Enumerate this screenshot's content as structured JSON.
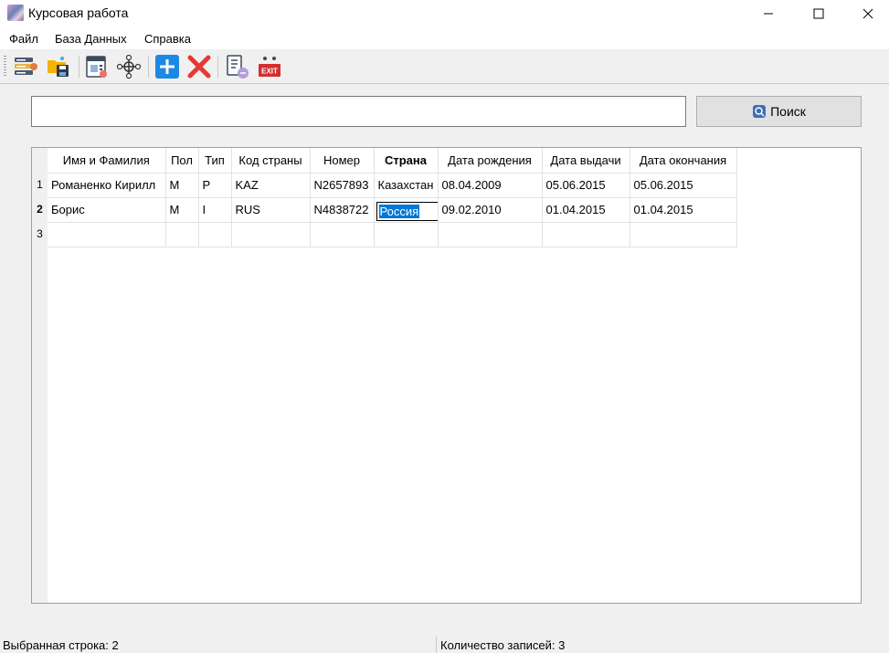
{
  "window": {
    "title": "Курсовая работа"
  },
  "menu": {
    "items": [
      "Файл",
      "База Данных",
      "Справка"
    ]
  },
  "toolbar": {
    "icons": [
      "database-list-icon",
      "folder-save-icon",
      "report-icon",
      "network-icon",
      "add-icon",
      "delete-icon",
      "edit-doc-icon",
      "exit-icon"
    ],
    "exit_label": "EXIT"
  },
  "search": {
    "value": "",
    "placeholder": "",
    "button_label": "Поиск"
  },
  "grid": {
    "columns": [
      "Имя и Фамилия",
      "Пол",
      "Тип",
      "Код страны",
      "Номер",
      "Страна",
      "Дата рождения",
      "Дата выдачи",
      "Дата окончания"
    ],
    "row_numbers": [
      "1",
      "2",
      "3"
    ],
    "rows": [
      [
        "Романенко Кирилл",
        "M",
        "P",
        "KAZ",
        "N2657893",
        "Казахстан",
        "08.04.2009",
        "05.06.2015",
        "05.06.2015"
      ],
      [
        "Борис",
        "M",
        "I",
        "RUS",
        "N4838722",
        "Россия",
        "09.02.2010",
        "01.04.2015",
        "01.04.2015"
      ],
      [
        "",
        "",
        "",
        "",
        "",
        "",
        "",
        "",
        ""
      ]
    ]
  },
  "status": {
    "selected_row": "Выбранная строка: 2",
    "record_count": "Количество записей: 3"
  },
  "colors": {
    "selection": "#0078d7",
    "add_blue": "#1e88e5",
    "delete_red": "#e53935",
    "exit_red": "#d32f2f"
  }
}
